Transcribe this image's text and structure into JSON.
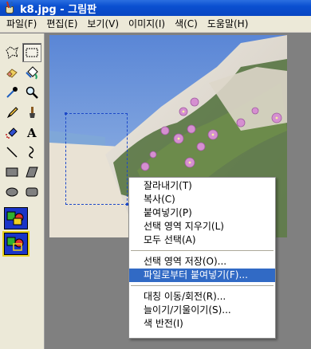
{
  "window": {
    "title": "k8.jpg - 그림판",
    "app_icon": "paint-icon"
  },
  "menubar": {
    "items": [
      "파일(F)",
      "편집(E)",
      "보기(V)",
      "이미지(I)",
      "색(C)",
      "도움말(H)"
    ]
  },
  "toolbox": {
    "tools": [
      "free-form-select-icon",
      "rect-select-icon",
      "eraser-icon",
      "fill-icon",
      "color-picker-icon",
      "magnifier-icon",
      "pencil-icon",
      "brush-icon",
      "airbrush-icon",
      "text-icon",
      "line-icon",
      "curve-icon",
      "rectangle-icon",
      "polygon-icon",
      "ellipse-icon",
      "rounded-rect-icon"
    ],
    "selected_tool": "rect-select-icon"
  },
  "context_menu": {
    "group1": [
      "잘라내기(T)",
      "복사(C)",
      "붙여넣기(P)",
      "선택 영역 지우기(L)",
      "모두 선택(A)"
    ],
    "group2": [
      "선택 영역 저장(O)...",
      "파일로부터 붙여넣기(F)..."
    ],
    "group3": [
      "대칭 이동/회전(R)...",
      "늘이기/기울이기(S)...",
      "색 반전(I)"
    ],
    "highlighted": "파일로부터 붙여넣기(F)..."
  },
  "colors": {
    "titlebar": "#0a4fd0",
    "highlight": "#316ac5",
    "workspace": "#808080"
  }
}
